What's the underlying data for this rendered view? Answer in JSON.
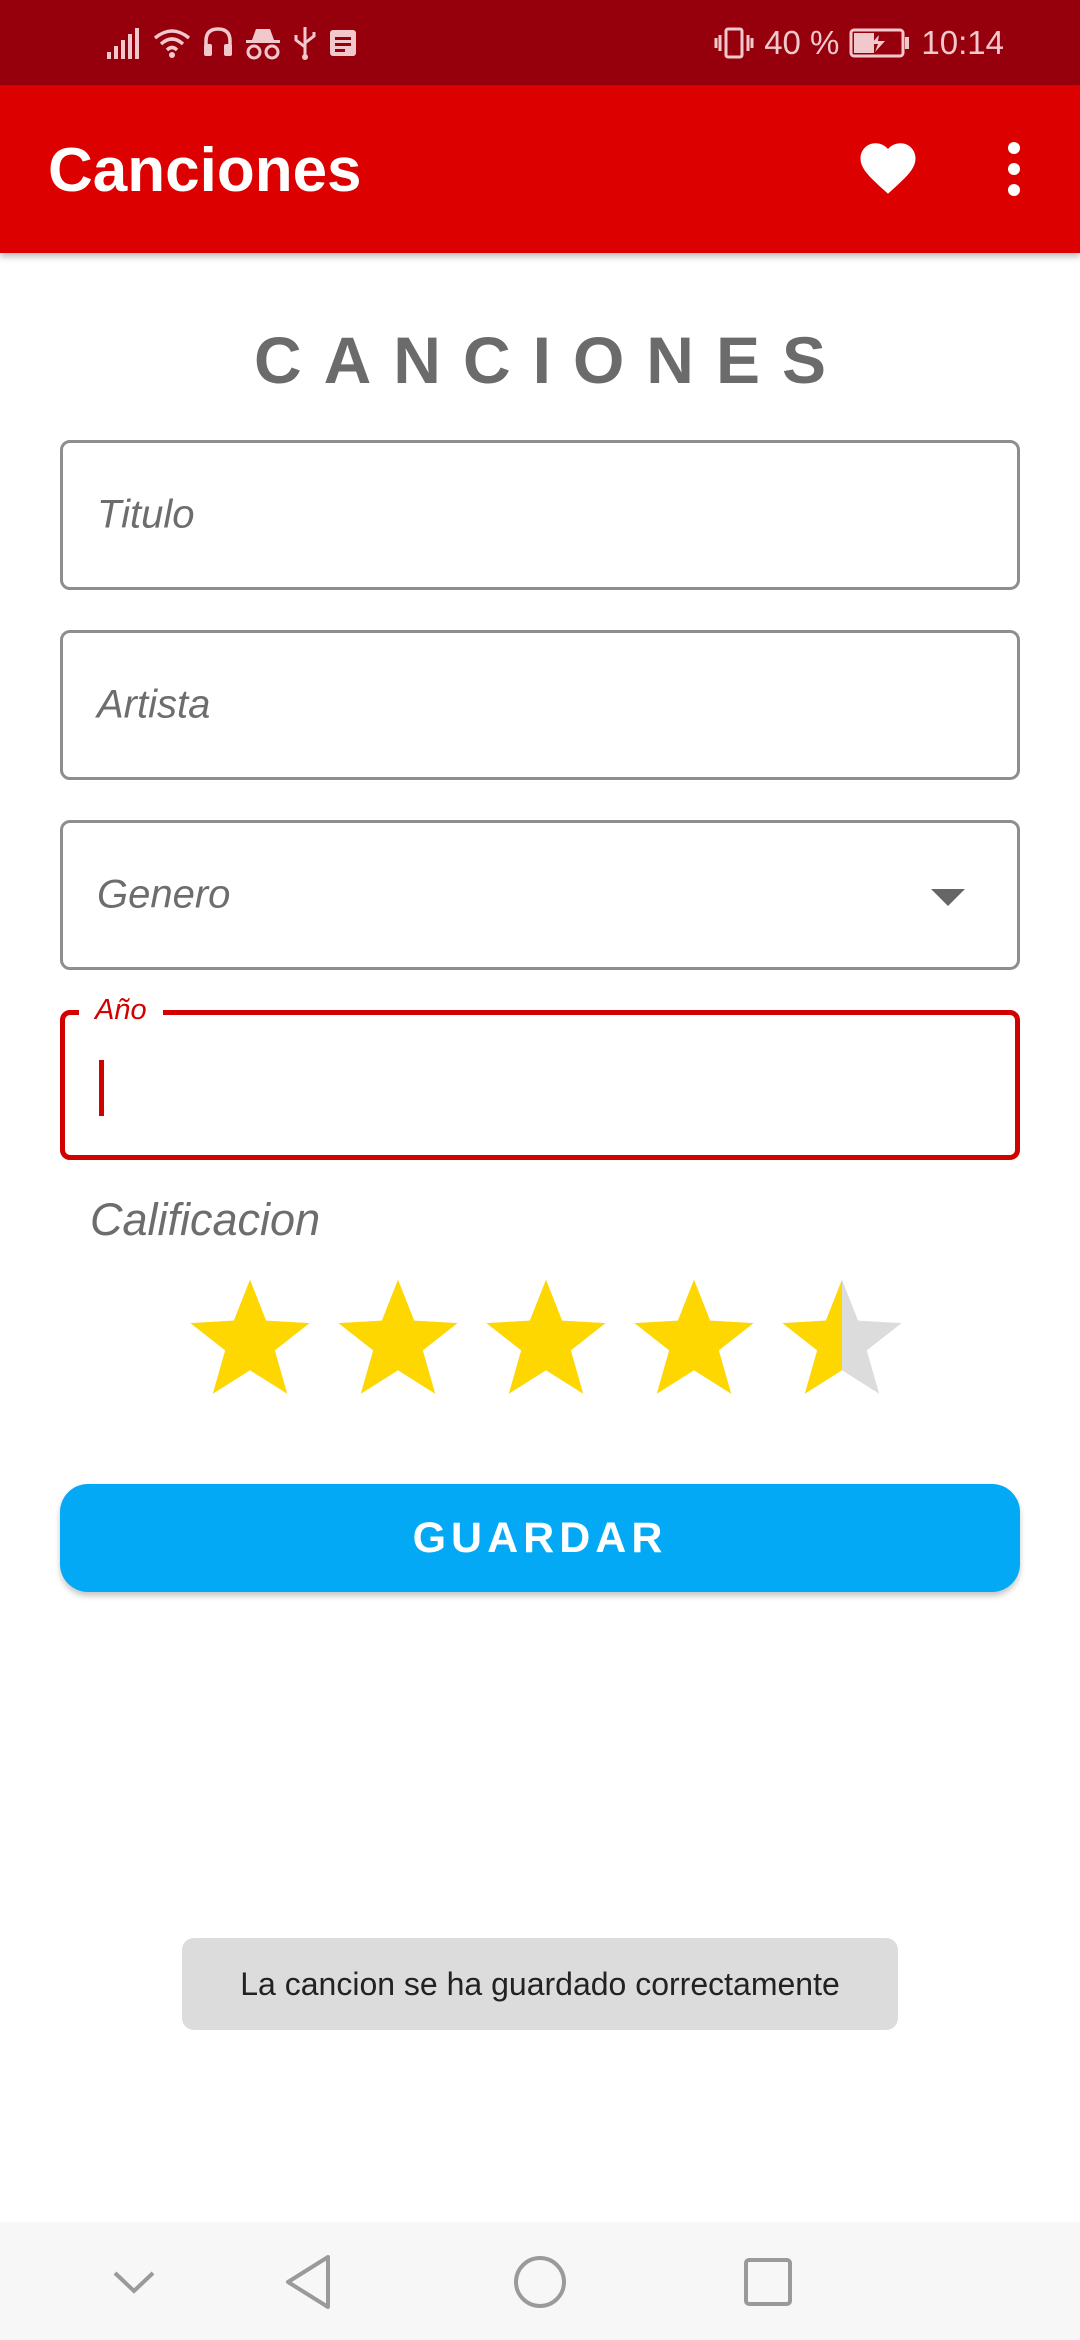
{
  "status_bar": {
    "battery_percent": "40 %",
    "time": "10:14",
    "icons": [
      "signal-icon",
      "wifi-icon",
      "headset-icon",
      "incognito-icon",
      "usb-icon",
      "notification-icon",
      "vibrate-icon",
      "battery-charging-icon"
    ]
  },
  "app_bar": {
    "title": "Canciones",
    "actions": [
      "heart-icon",
      "more-vert-icon"
    ]
  },
  "form": {
    "heading": "CANCIONES",
    "title_placeholder": "Titulo",
    "artist_placeholder": "Artista",
    "genre_placeholder": "Genero",
    "year_label": "Año",
    "year_value": "",
    "rating_label": "Calificacion",
    "rating_value": 4.5,
    "rating_max": 5,
    "save_label": "GUARDAR"
  },
  "toast": {
    "message": "La cancion se ha guardado correctamente"
  },
  "nav_bar": {
    "icons": [
      "chevron-down-icon",
      "back-icon",
      "home-icon",
      "recents-icon"
    ]
  },
  "colors": {
    "status_bar": "#96000c",
    "app_bar": "#dd0000",
    "accent": "#d30000",
    "button": "#03a9f4",
    "star_filled": "#ffd700",
    "star_empty": "#dcdcdc"
  }
}
